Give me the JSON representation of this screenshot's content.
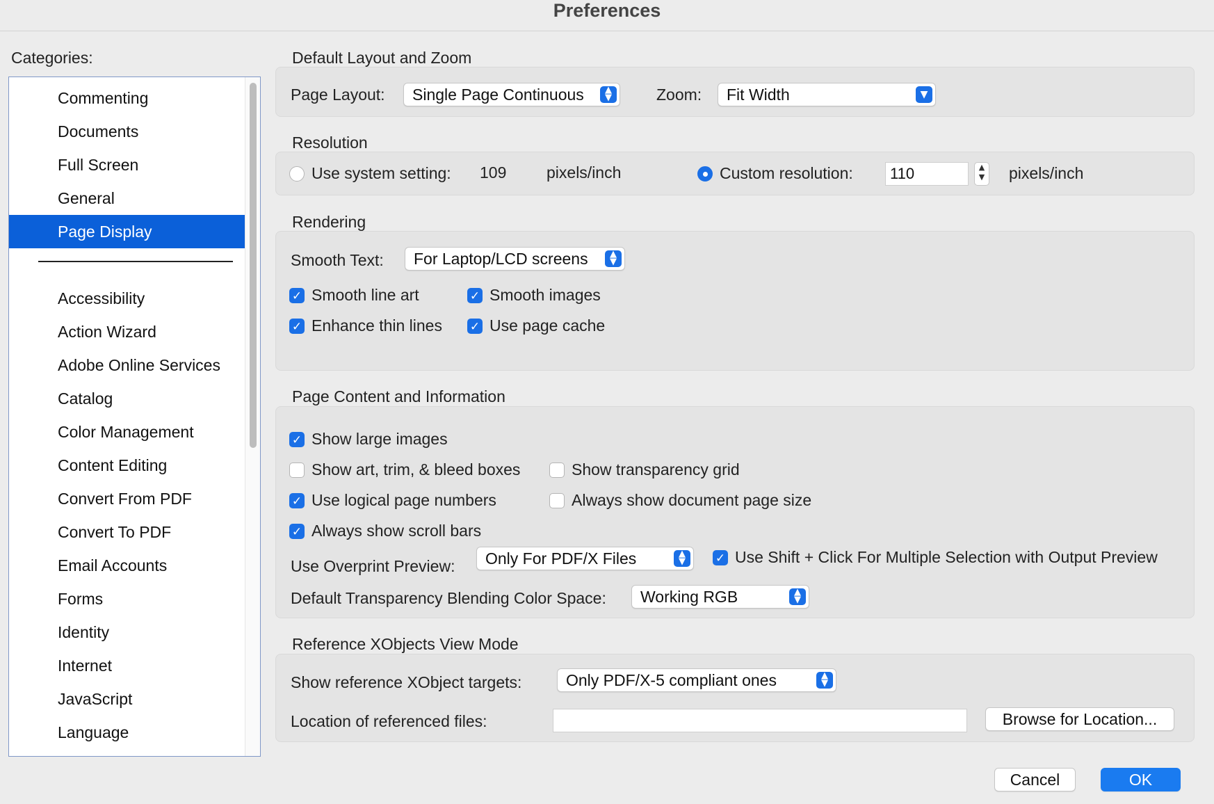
{
  "window": {
    "title": "Preferences"
  },
  "categories": {
    "heading": "Categories:",
    "top_items": [
      "Commenting",
      "Documents",
      "Full Screen",
      "General",
      "Page Display"
    ],
    "selected": "Page Display",
    "items": [
      "Accessibility",
      "Action Wizard",
      "Adobe Online Services",
      "Catalog",
      "Color Management",
      "Content Editing",
      "Convert From PDF",
      "Convert To PDF",
      "Email Accounts",
      "Forms",
      "Identity",
      "Internet",
      "JavaScript",
      "Language"
    ]
  },
  "layout_zoom": {
    "title": "Default Layout and Zoom",
    "page_layout_label": "Page Layout:",
    "page_layout_value": "Single Page Continuous",
    "zoom_label": "Zoom:",
    "zoom_value": "Fit Width"
  },
  "resolution": {
    "title": "Resolution",
    "system_label": "Use system setting:",
    "system_value": "109",
    "system_unit": "pixels/inch",
    "system_selected": false,
    "custom_label": "Custom resolution:",
    "custom_value": "110",
    "custom_unit": "pixels/inch",
    "custom_selected": true
  },
  "rendering": {
    "title": "Rendering",
    "smooth_text_label": "Smooth Text:",
    "smooth_text_value": "For Laptop/LCD screens",
    "smooth_line_art": "Smooth line art",
    "smooth_images": "Smooth images",
    "enhance_thin_lines": "Enhance thin lines",
    "use_page_cache": "Use page cache"
  },
  "page_content": {
    "title": "Page Content and Information",
    "show_large_images": "Show large images",
    "show_boxes": "Show art, trim, & bleed boxes",
    "show_transparency_grid": "Show transparency grid",
    "use_logical_numbers": "Use logical page numbers",
    "always_show_page_size": "Always show document page size",
    "always_show_scroll_bars": "Always show scroll bars",
    "overprint_label": "Use Overprint Preview:",
    "overprint_value": "Only For PDF/X Files",
    "shift_click": "Use Shift + Click For Multiple Selection with Output Preview",
    "blending_label": "Default Transparency Blending Color Space:",
    "blending_value": "Working RGB"
  },
  "xobjects": {
    "title": "Reference XObjects View Mode",
    "targets_label": "Show reference XObject targets:",
    "targets_value": "Only PDF/X-5 compliant ones",
    "location_label": "Location of referenced files:",
    "location_value": "",
    "browse_label": "Browse for Location..."
  },
  "footer": {
    "cancel": "Cancel",
    "ok": "OK"
  },
  "colors": {
    "accent": "#1a6fe6",
    "selection": "#0b60d9",
    "background": "#ececec"
  }
}
